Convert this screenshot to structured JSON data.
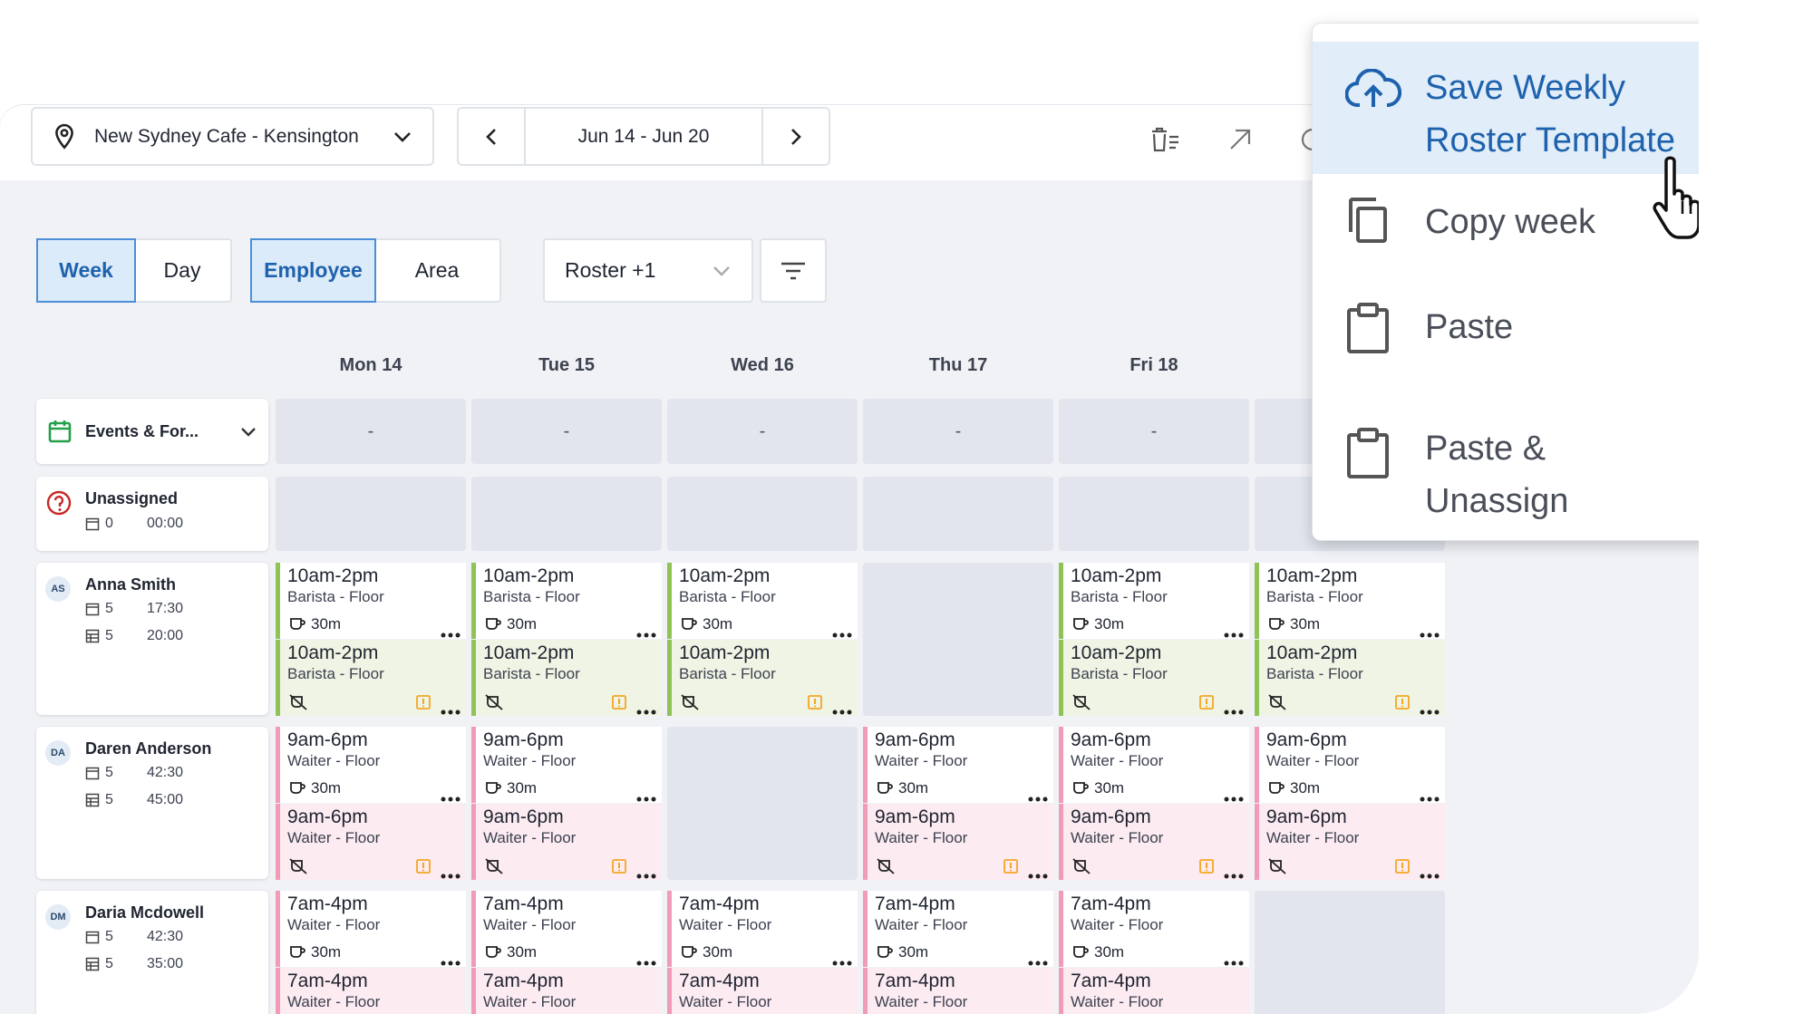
{
  "header": {
    "location": "New Sydney Cafe - Kensington",
    "date_range": "Jun 14 - Jun 20"
  },
  "view_toggle": {
    "week": "Week",
    "day": "Day",
    "active": "Week"
  },
  "group_toggle": {
    "employee": "Employee",
    "area": "Area",
    "active": "Employee"
  },
  "roster_select": {
    "value": "Roster +1"
  },
  "days": [
    "Mon 14",
    "Tue 15",
    "Wed 16",
    "Thu 17",
    "Fri 18"
  ],
  "events_row": {
    "label": "Events & For...",
    "values": [
      "-",
      "-",
      "-",
      "-",
      "-"
    ]
  },
  "unassigned": {
    "label": "Unassigned",
    "shifts": "0",
    "hours": "00:00"
  },
  "employees": [
    {
      "initials": "AS",
      "name": "Anna Smith",
      "shifts": "5",
      "hours": "17:30",
      "sched_shifts": "5",
      "sched_hours": "20:00"
    },
    {
      "initials": "DA",
      "name": "Daren Anderson",
      "shifts": "5",
      "hours": "42:30",
      "sched_shifts": "5",
      "sched_hours": "45:00"
    },
    {
      "initials": "DM",
      "name": "Daria Mcdowell",
      "shifts": "5",
      "hours": "42:30",
      "sched_shifts": "5",
      "sched_hours": "35:00"
    }
  ],
  "shift_templates": {
    "anna": {
      "time": "10am-2pm",
      "role": "Barista - Floor",
      "break": "30m",
      "color": "#8fc356"
    },
    "daren": {
      "time": "9am-6pm",
      "role": "Waiter - Floor",
      "break": "30m",
      "color": "#f29bb8"
    },
    "daria": {
      "time": "7am-4pm",
      "role": "Waiter - Floor",
      "break": "30m",
      "color": "#f29bb8"
    }
  },
  "menu": {
    "items": [
      {
        "label_line1": "Save Weekly",
        "label_line2": "Roster Template",
        "icon": "cloud-upload-icon",
        "highlighted": true
      },
      {
        "label_line1": "Copy week",
        "icon": "copy-icon"
      },
      {
        "label_line1": "Paste",
        "icon": "clipboard-icon"
      },
      {
        "label_line1": "Paste &",
        "label_line2": "Unassign",
        "icon": "clipboard-icon"
      }
    ]
  },
  "colors": {
    "accent": "#1e62ad",
    "highlight": "#dcebfa",
    "barista": "#8fc356",
    "waiter": "#f29bb8",
    "warning": "#f5a623"
  }
}
